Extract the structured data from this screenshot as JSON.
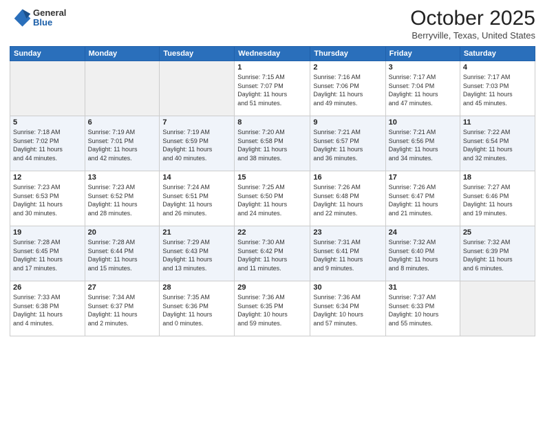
{
  "logo": {
    "general": "General",
    "blue": "Blue"
  },
  "header": {
    "month": "October 2025",
    "location": "Berryville, Texas, United States"
  },
  "weekdays": [
    "Sunday",
    "Monday",
    "Tuesday",
    "Wednesday",
    "Thursday",
    "Friday",
    "Saturday"
  ],
  "weeks": [
    [
      {
        "day": "",
        "info": ""
      },
      {
        "day": "",
        "info": ""
      },
      {
        "day": "",
        "info": ""
      },
      {
        "day": "1",
        "info": "Sunrise: 7:15 AM\nSunset: 7:07 PM\nDaylight: 11 hours\nand 51 minutes."
      },
      {
        "day": "2",
        "info": "Sunrise: 7:16 AM\nSunset: 7:06 PM\nDaylight: 11 hours\nand 49 minutes."
      },
      {
        "day": "3",
        "info": "Sunrise: 7:17 AM\nSunset: 7:04 PM\nDaylight: 11 hours\nand 47 minutes."
      },
      {
        "day": "4",
        "info": "Sunrise: 7:17 AM\nSunset: 7:03 PM\nDaylight: 11 hours\nand 45 minutes."
      }
    ],
    [
      {
        "day": "5",
        "info": "Sunrise: 7:18 AM\nSunset: 7:02 PM\nDaylight: 11 hours\nand 44 minutes."
      },
      {
        "day": "6",
        "info": "Sunrise: 7:19 AM\nSunset: 7:01 PM\nDaylight: 11 hours\nand 42 minutes."
      },
      {
        "day": "7",
        "info": "Sunrise: 7:19 AM\nSunset: 6:59 PM\nDaylight: 11 hours\nand 40 minutes."
      },
      {
        "day": "8",
        "info": "Sunrise: 7:20 AM\nSunset: 6:58 PM\nDaylight: 11 hours\nand 38 minutes."
      },
      {
        "day": "9",
        "info": "Sunrise: 7:21 AM\nSunset: 6:57 PM\nDaylight: 11 hours\nand 36 minutes."
      },
      {
        "day": "10",
        "info": "Sunrise: 7:21 AM\nSunset: 6:56 PM\nDaylight: 11 hours\nand 34 minutes."
      },
      {
        "day": "11",
        "info": "Sunrise: 7:22 AM\nSunset: 6:54 PM\nDaylight: 11 hours\nand 32 minutes."
      }
    ],
    [
      {
        "day": "12",
        "info": "Sunrise: 7:23 AM\nSunset: 6:53 PM\nDaylight: 11 hours\nand 30 minutes."
      },
      {
        "day": "13",
        "info": "Sunrise: 7:23 AM\nSunset: 6:52 PM\nDaylight: 11 hours\nand 28 minutes."
      },
      {
        "day": "14",
        "info": "Sunrise: 7:24 AM\nSunset: 6:51 PM\nDaylight: 11 hours\nand 26 minutes."
      },
      {
        "day": "15",
        "info": "Sunrise: 7:25 AM\nSunset: 6:50 PM\nDaylight: 11 hours\nand 24 minutes."
      },
      {
        "day": "16",
        "info": "Sunrise: 7:26 AM\nSunset: 6:48 PM\nDaylight: 11 hours\nand 22 minutes."
      },
      {
        "day": "17",
        "info": "Sunrise: 7:26 AM\nSunset: 6:47 PM\nDaylight: 11 hours\nand 21 minutes."
      },
      {
        "day": "18",
        "info": "Sunrise: 7:27 AM\nSunset: 6:46 PM\nDaylight: 11 hours\nand 19 minutes."
      }
    ],
    [
      {
        "day": "19",
        "info": "Sunrise: 7:28 AM\nSunset: 6:45 PM\nDaylight: 11 hours\nand 17 minutes."
      },
      {
        "day": "20",
        "info": "Sunrise: 7:28 AM\nSunset: 6:44 PM\nDaylight: 11 hours\nand 15 minutes."
      },
      {
        "day": "21",
        "info": "Sunrise: 7:29 AM\nSunset: 6:43 PM\nDaylight: 11 hours\nand 13 minutes."
      },
      {
        "day": "22",
        "info": "Sunrise: 7:30 AM\nSunset: 6:42 PM\nDaylight: 11 hours\nand 11 minutes."
      },
      {
        "day": "23",
        "info": "Sunrise: 7:31 AM\nSunset: 6:41 PM\nDaylight: 11 hours\nand 9 minutes."
      },
      {
        "day": "24",
        "info": "Sunrise: 7:32 AM\nSunset: 6:40 PM\nDaylight: 11 hours\nand 8 minutes."
      },
      {
        "day": "25",
        "info": "Sunrise: 7:32 AM\nSunset: 6:39 PM\nDaylight: 11 hours\nand 6 minutes."
      }
    ],
    [
      {
        "day": "26",
        "info": "Sunrise: 7:33 AM\nSunset: 6:38 PM\nDaylight: 11 hours\nand 4 minutes."
      },
      {
        "day": "27",
        "info": "Sunrise: 7:34 AM\nSunset: 6:37 PM\nDaylight: 11 hours\nand 2 minutes."
      },
      {
        "day": "28",
        "info": "Sunrise: 7:35 AM\nSunset: 6:36 PM\nDaylight: 11 hours\nand 0 minutes."
      },
      {
        "day": "29",
        "info": "Sunrise: 7:36 AM\nSunset: 6:35 PM\nDaylight: 10 hours\nand 59 minutes."
      },
      {
        "day": "30",
        "info": "Sunrise: 7:36 AM\nSunset: 6:34 PM\nDaylight: 10 hours\nand 57 minutes."
      },
      {
        "day": "31",
        "info": "Sunrise: 7:37 AM\nSunset: 6:33 PM\nDaylight: 10 hours\nand 55 minutes."
      },
      {
        "day": "",
        "info": ""
      }
    ]
  ]
}
